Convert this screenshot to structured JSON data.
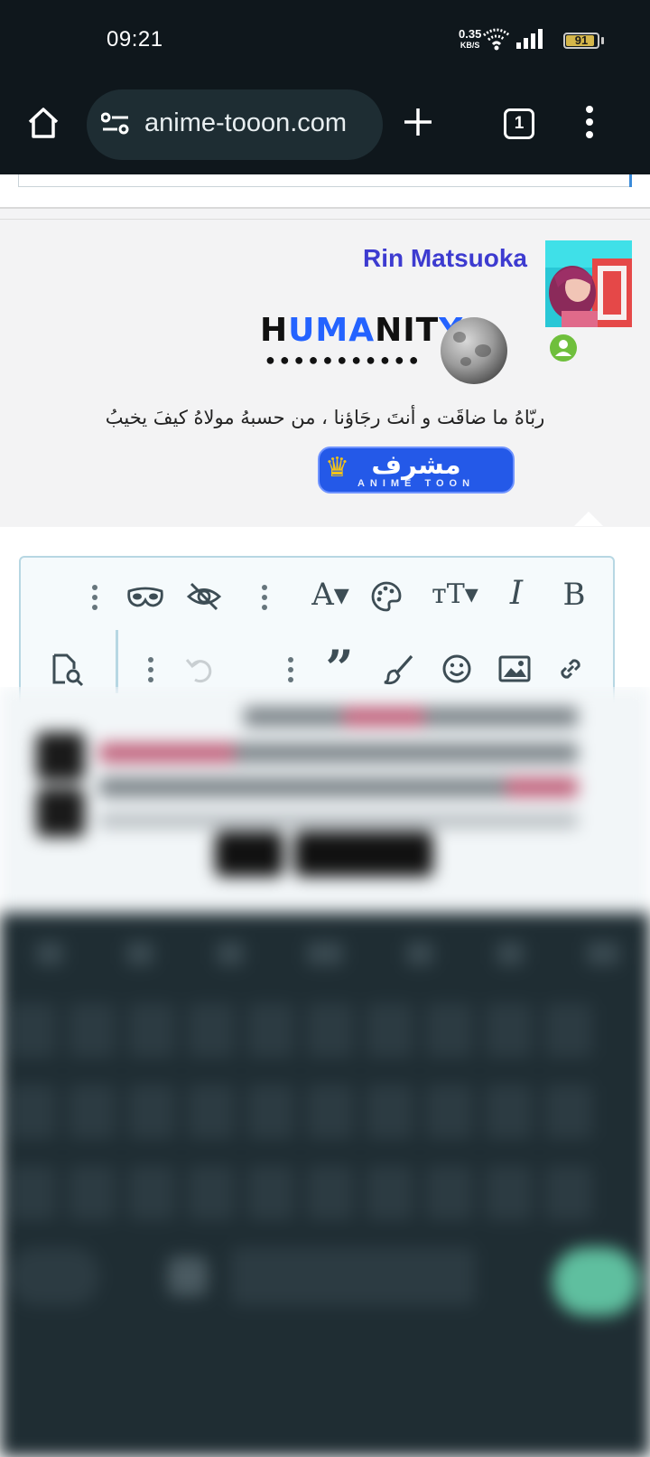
{
  "status_bar": {
    "time": "09:21",
    "net_speed": "0.35",
    "net_unit": "KB/S",
    "battery": "91",
    "battery_level": 0.91
  },
  "browser": {
    "url": "anime-tooon.com",
    "tab_count": "1",
    "icons": [
      "home-icon",
      "site-settings-icon",
      "new-tab-icon",
      "tab-switcher-icon",
      "overflow-menu-icon"
    ]
  },
  "post": {
    "username": "Rin Matsuoka",
    "username_color": "#3d3bd0",
    "signature_title_parts": [
      "H",
      "UMA",
      "NIT",
      "Y"
    ],
    "signature_dots": "●●●●●●●●●●●",
    "signature_text": "ربّاهُ ما ضاقَت و أنتَ رجَاؤنا ، من حسبهُ مولاهُ كيفَ يخيبُ",
    "badge": {
      "label": "مشرف",
      "sub": "ANIME TOON",
      "color": "#2459e8"
    },
    "online_color": "#6fbf3c"
  },
  "editor": {
    "toolbar_row1": [
      "bold-icon",
      "italic-icon",
      "text-size-icon",
      "color-palette-icon",
      "font-family-icon",
      "more-options-icon",
      "hide-content-icon",
      "spoiler-mask-icon",
      "more-options-icon"
    ],
    "toolbar_row2": [
      "link-icon",
      "image-icon",
      "emoji-icon",
      "brush-icon",
      "quote-icon",
      "more-options-icon",
      "undo-icon",
      "more-options-icon",
      "preview-icon"
    ]
  }
}
